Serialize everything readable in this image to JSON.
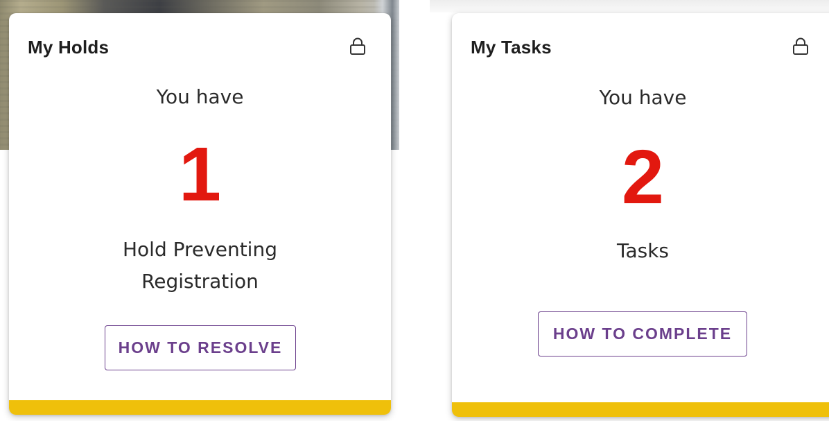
{
  "colors": {
    "count": "#e2180f",
    "button": "#6b3f8c",
    "accent_bar": "#efc00b"
  },
  "holds_card": {
    "title": "My Holds",
    "icon": "lock-icon",
    "intro": "You have",
    "count": "1",
    "label_line1": "Hold Preventing",
    "label_line2": "Registration",
    "button_label": "HOW TO RESOLVE"
  },
  "tasks_card": {
    "title": "My Tasks",
    "icon": "lock-icon",
    "intro": "You have",
    "count": "2",
    "label_line1": "Tasks",
    "button_label": "HOW TO COMPLETE"
  }
}
